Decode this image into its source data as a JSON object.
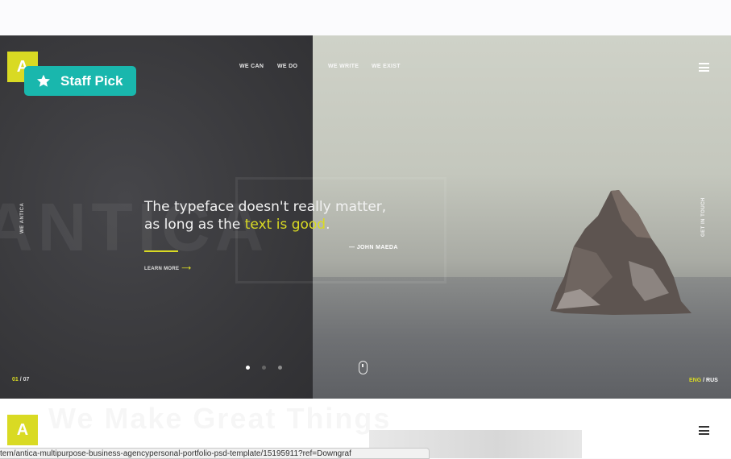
{
  "hero": {
    "bigword": "ANTICA",
    "logo_letter": "A",
    "nav": [
      "WE CAN",
      "WE DO",
      "WE WRITE",
      "WE EXIST"
    ],
    "left_vertical": "WE ANTICA",
    "right_vertical": "GET IN TOUCH",
    "quote": {
      "line1": "The typeface doesn't really matter,",
      "line2_pre": "as long as the ",
      "line2_hl": "text is good",
      "line2_post": "."
    },
    "author": "— JOHN MAEDA",
    "learn_more": "LEARN MORE",
    "arrow": "⟶",
    "counter_current": "01",
    "counter_sep": " / ",
    "counter_total": "07",
    "lang_active": "ENG",
    "lang_sep": " / ",
    "lang_other": "RUS",
    "accent": "#d9da23"
  },
  "badge": {
    "label": "Staff Pick",
    "color": "#19b7ad",
    "icon": "star-icon"
  },
  "bottom": {
    "logo_letter": "A",
    "ghost_title": "We Make Great Things"
  },
  "status_bar": {
    "url": "tem/antica-multipurpose-business-agencypersonal-portfolio-psd-template/15195911?ref=Downgraf"
  }
}
